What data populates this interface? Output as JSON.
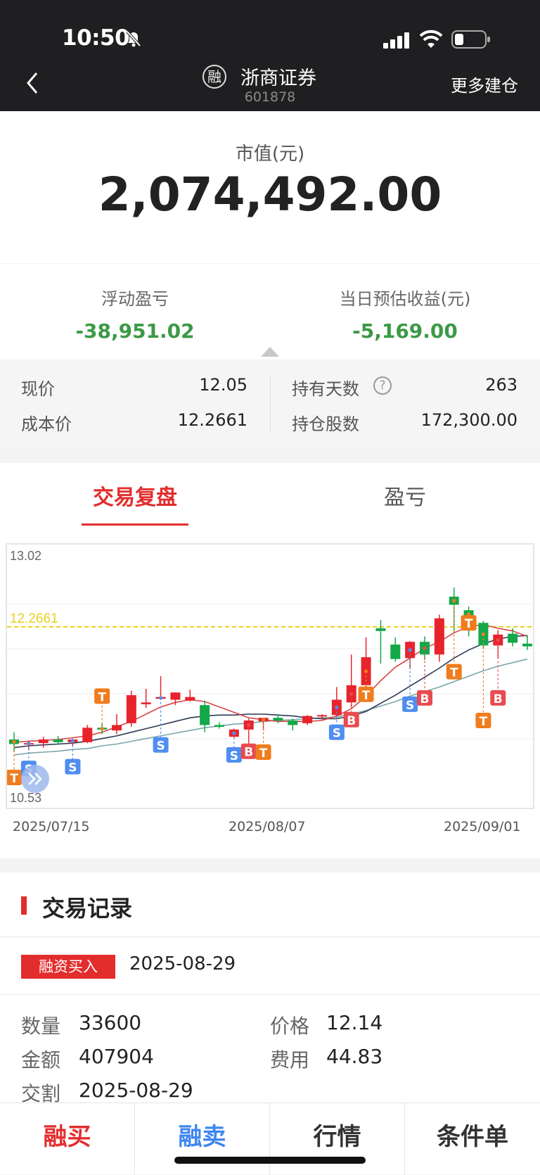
{
  "status_bar": {
    "time": "10:50"
  },
  "header": {
    "logo_char": "融",
    "stock_name": "浙商证券",
    "stock_code": "601878",
    "more_build": "更多建仓"
  },
  "market_value": {
    "label": "市值(元)",
    "value": "2,074,492.00"
  },
  "pl": {
    "floating_label": "浮动盈亏",
    "floating_value": "-38,951.02",
    "daily_label": "当日预估收益(元)",
    "daily_value": "-5,169.00"
  },
  "position": {
    "current_price_label": "现价",
    "current_price": "12.05",
    "cost_price_label": "成本价",
    "cost_price": "12.2661",
    "hold_days_label": "持有天数",
    "hold_days": "263",
    "hold_shares_label": "持仓股数",
    "hold_shares": "172,300.00"
  },
  "tabs": [
    {
      "label": "交易复盘"
    },
    {
      "label": "盈亏"
    }
  ],
  "chart_data": {
    "type": "candlestick",
    "y_top_label": "13.02",
    "y_bottom_label": "10.53",
    "cost_line_label": "12.2661",
    "cost_line": 12.2661,
    "ylim": [
      10.53,
      13.02
    ],
    "x_labels": [
      "2025/07/15",
      "2025/08/07",
      "2025/09/01"
    ],
    "colors": {
      "up": "#e7242c",
      "down": "#13a849",
      "cost_line": "#e6d11b",
      "ma1": "#d84545",
      "ma2": "#2b3a55",
      "ma3": "#7aa7a8"
    },
    "candles": [
      {
        "o": 11.02,
        "h": 11.1,
        "l": 10.88,
        "c": 10.97
      },
      {
        "o": 10.97,
        "h": 11.01,
        "l": 10.9,
        "c": 10.98
      },
      {
        "o": 10.98,
        "h": 11.05,
        "l": 10.93,
        "c": 11.02
      },
      {
        "o": 11.02,
        "h": 11.06,
        "l": 10.96,
        "c": 10.99
      },
      {
        "o": 10.99,
        "h": 11.03,
        "l": 10.95,
        "c": 11.02
      },
      {
        "o": 10.99,
        "h": 11.18,
        "l": 10.98,
        "c": 11.15
      },
      {
        "o": 11.15,
        "h": 11.2,
        "l": 11.08,
        "c": 11.13
      },
      {
        "o": 11.12,
        "h": 11.3,
        "l": 11.08,
        "c": 11.18
      },
      {
        "o": 11.2,
        "h": 11.56,
        "l": 11.16,
        "c": 11.51
      },
      {
        "o": 11.41,
        "h": 11.58,
        "l": 11.37,
        "c": 11.43
      },
      {
        "o": 11.47,
        "h": 11.72,
        "l": 11.46,
        "c": 11.49
      },
      {
        "o": 11.46,
        "h": 11.54,
        "l": 11.4,
        "c": 11.54
      },
      {
        "o": 11.45,
        "h": 11.57,
        "l": 11.44,
        "c": 11.49
      },
      {
        "o": 11.4,
        "h": 11.45,
        "l": 11.1,
        "c": 11.18
      },
      {
        "o": 11.18,
        "h": 11.21,
        "l": 11.14,
        "c": 11.16
      },
      {
        "o": 11.05,
        "h": 11.14,
        "l": 11.04,
        "c": 11.13
      },
      {
        "o": 11.13,
        "h": 11.25,
        "l": 10.96,
        "c": 11.23
      },
      {
        "o": 11.22,
        "h": 11.26,
        "l": 11.12,
        "c": 11.26
      },
      {
        "o": 11.26,
        "h": 11.3,
        "l": 11.2,
        "c": 11.23
      },
      {
        "o": 11.23,
        "h": 11.25,
        "l": 11.12,
        "c": 11.18
      },
      {
        "o": 11.2,
        "h": 11.29,
        "l": 11.18,
        "c": 11.28
      },
      {
        "o": 11.28,
        "h": 11.3,
        "l": 11.24,
        "c": 11.29
      },
      {
        "o": 11.29,
        "h": 11.6,
        "l": 11.27,
        "c": 11.46
      },
      {
        "o": 11.43,
        "h": 11.96,
        "l": 11.38,
        "c": 11.62
      },
      {
        "o": 11.62,
        "h": 12.15,
        "l": 11.54,
        "c": 11.93
      },
      {
        "o": 12.25,
        "h": 12.34,
        "l": 11.86,
        "c": 12.22
      },
      {
        "o": 12.07,
        "h": 12.15,
        "l": 11.88,
        "c": 11.91
      },
      {
        "o": 11.92,
        "h": 12.11,
        "l": 11.8,
        "c": 12.1
      },
      {
        "o": 12.1,
        "h": 12.16,
        "l": 11.9,
        "c": 11.96
      },
      {
        "o": 11.96,
        "h": 12.4,
        "l": 11.88,
        "c": 12.36
      },
      {
        "o": 12.6,
        "h": 12.7,
        "l": 12.2,
        "c": 12.51
      },
      {
        "o": 12.45,
        "h": 12.49,
        "l": 12.16,
        "c": 12.36
      },
      {
        "o": 12.31,
        "h": 12.33,
        "l": 12.02,
        "c": 12.06
      },
      {
        "o": 12.06,
        "h": 12.23,
        "l": 11.92,
        "c": 12.18
      },
      {
        "o": 12.19,
        "h": 12.25,
        "l": 12.05,
        "c": 12.09
      },
      {
        "o": 12.08,
        "h": 12.17,
        "l": 12.01,
        "c": 12.05
      }
    ],
    "ma1": [
      10.99,
      11.0,
      11.01,
      11.02,
      11.04,
      11.06,
      11.1,
      11.16,
      11.22,
      11.3,
      11.38,
      11.43,
      11.46,
      11.44,
      11.38,
      11.32,
      11.26,
      11.24,
      11.22,
      11.22,
      11.22,
      11.23,
      11.28,
      11.36,
      11.5,
      11.67,
      11.82,
      11.92,
      12.03,
      12.1,
      12.2,
      12.27,
      12.29,
      12.25,
      12.22,
      12.16
    ],
    "ma2": [
      10.93,
      10.95,
      10.96,
      10.97,
      10.98,
      11.0,
      11.03,
      11.06,
      11.1,
      11.14,
      11.18,
      11.22,
      11.26,
      11.28,
      11.29,
      11.29,
      11.3,
      11.3,
      11.29,
      11.28,
      11.26,
      11.25,
      11.25,
      11.28,
      11.33,
      11.42,
      11.51,
      11.61,
      11.71,
      11.81,
      11.92,
      12.01,
      12.08,
      12.13,
      12.16,
      12.17
    ],
    "ma3": [
      10.85,
      10.87,
      10.88,
      10.89,
      10.91,
      10.92,
      10.95,
      10.97,
      11.0,
      11.03,
      11.06,
      11.09,
      11.12,
      11.15,
      11.17,
      11.19,
      11.2,
      11.22,
      11.23,
      11.24,
      11.25,
      11.26,
      11.27,
      11.3,
      11.34,
      11.39,
      11.44,
      11.5,
      11.55,
      11.6,
      11.66,
      11.72,
      11.78,
      11.83,
      11.87,
      11.91
    ],
    "markers": [
      {
        "i": 0,
        "label": "T",
        "color": "#f07c1e",
        "price": 10.6
      },
      {
        "i": 1,
        "label": "S",
        "color": "#4f8ef0",
        "price": 10.7
      },
      {
        "i": 4,
        "label": "S",
        "color": "#4f8ef0",
        "price": 10.72
      },
      {
        "i": 6,
        "label": "T",
        "color": "#f07c1e",
        "price": 11.5
      },
      {
        "i": 10,
        "label": "S",
        "color": "#4f8ef0",
        "price": 10.96
      },
      {
        "i": 15,
        "label": "S",
        "color": "#4f8ef0",
        "price": 10.85
      },
      {
        "i": 16,
        "label": "B",
        "color": "#e84b50",
        "price": 10.89
      },
      {
        "i": 17,
        "label": "T",
        "color": "#f07c1e",
        "price": 10.88
      },
      {
        "i": 22,
        "label": "S",
        "color": "#4f8ef0",
        "price": 11.1
      },
      {
        "i": 23,
        "label": "B",
        "color": "#e84b50",
        "price": 11.24
      },
      {
        "i": 24,
        "label": "T",
        "color": "#f07c1e",
        "price": 11.52
      },
      {
        "i": 27,
        "label": "S",
        "color": "#4f8ef0",
        "price": 11.41
      },
      {
        "i": 28,
        "label": "B",
        "color": "#e84b50",
        "price": 11.48
      },
      {
        "i": 30,
        "label": "T",
        "color": "#f07c1e",
        "price": 11.77
      },
      {
        "i": 31,
        "label": "T",
        "color": "#f07c1e",
        "price": 12.31
      },
      {
        "i": 32,
        "label": "T",
        "color": "#f07c1e",
        "price": 11.23
      },
      {
        "i": 33,
        "label": "B",
        "color": "#e84b50",
        "price": 11.48
      }
    ]
  },
  "records": {
    "title": "交易记录",
    "item": {
      "badge": "融资买入",
      "date": "2025-08-29",
      "qty_label": "数量",
      "qty": "33600",
      "price_label": "价格",
      "price": "12.14",
      "amount_label": "金额",
      "amount": "407904",
      "fee_label": "费用",
      "fee": "44.83",
      "settle_label": "交割",
      "settle": "2025-08-29"
    }
  },
  "bottom_bar": {
    "buy": "融买",
    "sell": "融卖",
    "quote": "行情",
    "conditional": "条件单",
    "buy_color": "#e32d2d",
    "sell_color": "#3f86f0",
    "default_color": "#333333"
  }
}
